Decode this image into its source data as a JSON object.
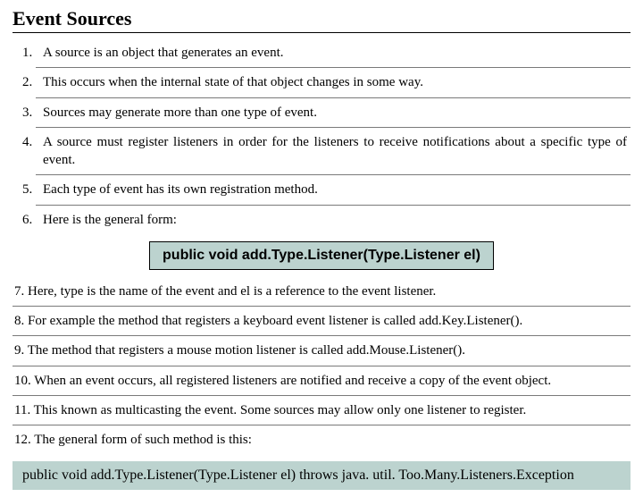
{
  "title": "Event Sources",
  "items_a": [
    "A source is an object that generates an event.",
    "This occurs when the internal state of that object changes in some way.",
    "Sources may generate more than one type of event.",
    "A source must register listeners in order for the listeners to receive notifications about a specific type of event.",
    "Each type of event has its own registration method.",
    "Here is the general form:"
  ],
  "code1": "public void add.Type.Listener(Type.Listener el)",
  "items_b": [
    "7. Here, type is the name of the event and el is a reference to the event listener.",
    "8. For example the method that registers a keyboard event listener is called add.Key.Listener().",
    "9. The method that registers a mouse motion listener is called add.Mouse.Listener().",
    "10. When an event occurs, all registered listeners are notified and receive a copy of the event object.",
    "11. This known as multicasting the event. Some sources may allow only one listener to register.",
    "12. The general form of such method is this:"
  ],
  "code2": "public void add.Type.Listener(Type.Listener el) throws java. util. Too.Many.Listeners.Exception"
}
